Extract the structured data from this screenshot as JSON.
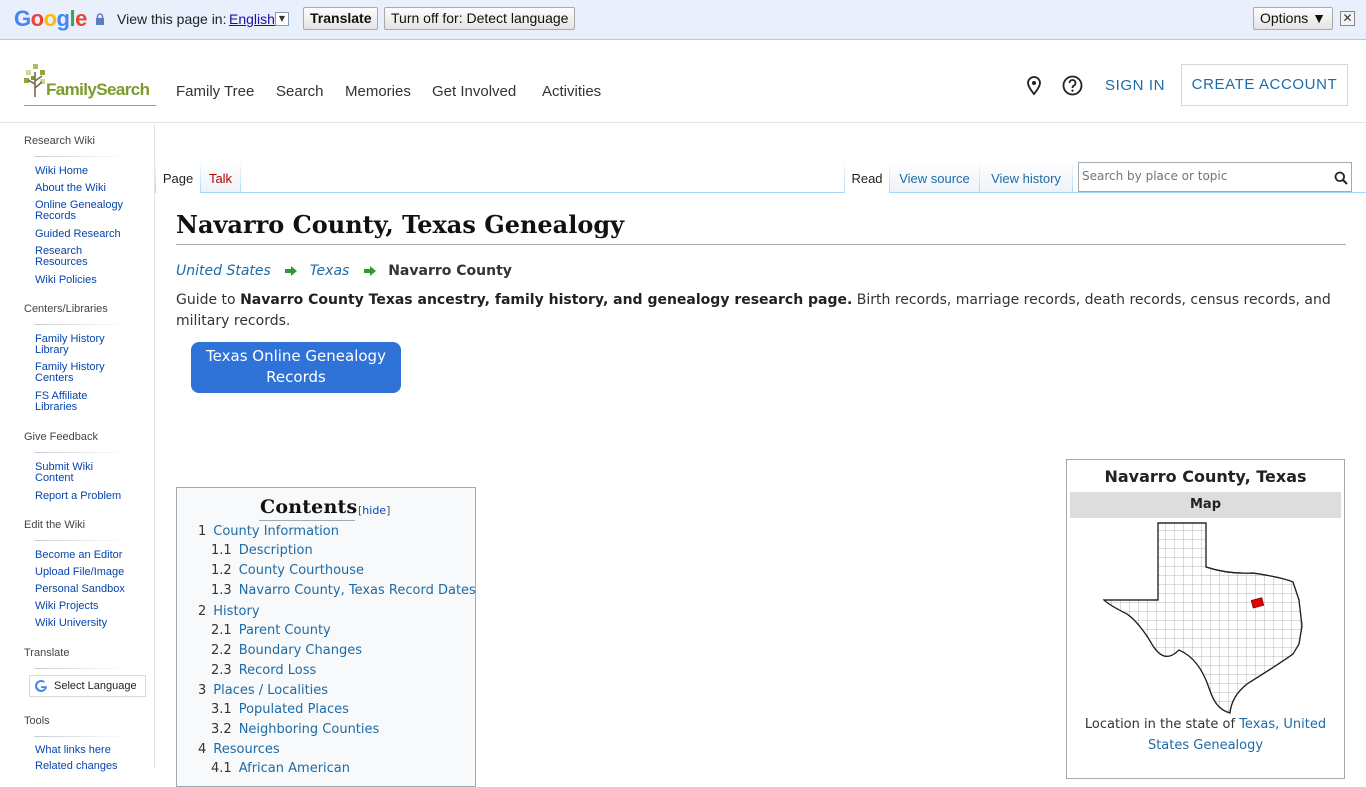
{
  "translate_bar": {
    "logo": "Google",
    "view_text": "View this page in:",
    "language": "English",
    "translate_label": "Translate",
    "turn_off_label": "Turn off for: Detect language",
    "options_label": "Options ▼",
    "close_glyph": "✕"
  },
  "header": {
    "logo_text": "FamilySearch",
    "nav": [
      "Family Tree",
      "Search",
      "Memories",
      "Get Involved",
      "Activities"
    ],
    "sign_in": "SIGN IN",
    "create_account": "CREATE ACCOUNT"
  },
  "sidebar": {
    "sections": [
      {
        "heading": "Research Wiki",
        "links": [
          "Wiki Home",
          "About the Wiki",
          "Online Genealogy Records",
          "Guided Research",
          "Research Resources",
          "Wiki Policies"
        ]
      },
      {
        "heading": "Centers/Libraries",
        "links": [
          "Family History Library",
          "Family History Centers",
          "FS Affiliate Libraries"
        ]
      },
      {
        "heading": "Give Feedback",
        "links": [
          "Submit Wiki Content",
          "Report a Problem"
        ]
      },
      {
        "heading": "Edit the Wiki",
        "links": [
          "Become an Editor",
          "Upload File/Image",
          "Personal Sandbox",
          "Wiki Projects",
          "Wiki University"
        ]
      },
      {
        "heading": "Translate",
        "links": []
      },
      {
        "heading": "Tools",
        "links": [
          "What links here",
          "Related changes"
        ]
      }
    ],
    "select_language": "Select Language"
  },
  "tabs": {
    "page": "Page",
    "talk": "Talk",
    "read": "Read",
    "view_source": "View source",
    "view_history": "View history"
  },
  "search": {
    "placeholder": "Search by place or topic"
  },
  "content": {
    "title": "Navarro County, Texas Genealogy",
    "breadcrumb": {
      "level1": "United States",
      "level2": "Texas",
      "current": "Navarro County"
    },
    "intro_prefix": "Guide to ",
    "intro_bold": "Navarro County Texas ancestry, family history, and genealogy research page.",
    "intro_rest": " Birth records, marriage records, death records, census records, and military records.",
    "cta_button": "Texas Online Genealogy Records"
  },
  "toc": {
    "title": "Contents",
    "toggle_open": "[",
    "toggle_label": "hide",
    "toggle_close": "]",
    "items": [
      {
        "num": "1",
        "text": "County Information"
      },
      {
        "num": "1.1",
        "text": "Description"
      },
      {
        "num": "1.2",
        "text": "County Courthouse"
      },
      {
        "num": "1.3",
        "text": "Navarro County, Texas Record Dates"
      },
      {
        "num": "2",
        "text": "History"
      },
      {
        "num": "2.1",
        "text": "Parent County"
      },
      {
        "num": "2.2",
        "text": "Boundary Changes"
      },
      {
        "num": "2.3",
        "text": "Record Loss"
      },
      {
        "num": "3",
        "text": "Places / Localities"
      },
      {
        "num": "3.1",
        "text": "Populated Places"
      },
      {
        "num": "3.2",
        "text": "Neighboring Counties"
      },
      {
        "num": "4",
        "text": "Resources"
      },
      {
        "num": "4.1",
        "text": "African American"
      }
    ]
  },
  "infobox": {
    "title": "Navarro County, Texas",
    "map_header": "Map",
    "caption_prefix": "Location in the state of ",
    "caption_link": "Texas, United States Genealogy"
  },
  "colors": {
    "link": "#1d6ba7",
    "brand_green": "#7b9b2f",
    "cta_blue": "#2f73d8",
    "highlight_red": "#e00000"
  }
}
